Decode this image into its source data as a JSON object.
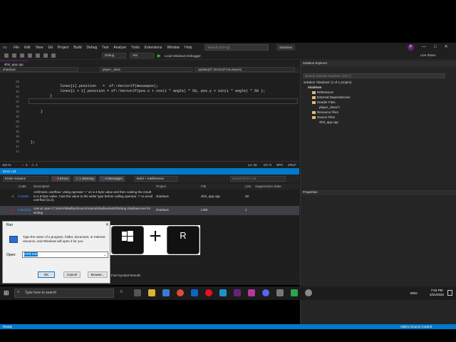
{
  "menubar": {
    "items": [
      "File",
      "Edit",
      "View",
      "Git",
      "Project",
      "Build",
      "Debug",
      "Test",
      "Analyze",
      "Tools",
      "Extensions",
      "Window",
      "Help"
    ],
    "search_placeholder": "Search (Ctrl+Q)",
    "title": "shadows",
    "avatar": "P",
    "win_min": "—",
    "win_max": "□",
    "win_close": "✕"
  },
  "toolbar": {
    "config": "Debug",
    "platform": "x64",
    "run_label": "Local Windows Debugger",
    "live_share": "Live Share"
  },
  "doc_tabs": [
    {
      "label": "sfml_app.cpp"
    }
  ],
  "navbar": {
    "project": "shadows",
    "scope": "player_class",
    "member": "update(sf::Vector2f mousepos)"
  },
  "editor": {
    "line_numbers": [
      "28",
      "29",
      "30",
      "31",
      "32",
      "33",
      "34",
      "35",
      "36",
      "37",
      "38",
      "39",
      "40",
      "41",
      "42"
    ],
    "lines": [
      {
        "t": "lines[i].position   =  sf::Vector2f(mousepos);"
      },
      {
        "t": "lines[i + 1].position = sf::Vector2f(pos.x + cos(i * angle) * 50, pos.y + sin(i * angle) * 50 );"
      },
      {
        "t": "}"
      },
      {
        "t": "}"
      },
      {
        "t": "};"
      }
    ],
    "status": {
      "zoom": "110 %",
      "errors": "2",
      "warnings": "1",
      "ln": "Ln: 32",
      "ch": "Ch: 9",
      "spc": "SPC",
      "crlf": "CRLF"
    }
  },
  "error_list": {
    "title": "Error List",
    "scope": "Entire Solution",
    "errors_btn": "2 Errors",
    "warnings_btn": "1 Warning",
    "messages_btn": "0 Messages",
    "build_filter": "Build + IntelliSense",
    "search_placeholder": "Search Error List",
    "headers": {
      "code": "Code",
      "desc": "Description",
      "project": "Project",
      "file": "File",
      "line": "Line",
      "supp": "Suppression State"
    },
    "rows": [
      {
        "code": "C26451",
        "desc": "Arithmetic overflow: Using operator '+' on a 4 byte value and then casting the result to a 8 byte value. Cast the value to the wider type before calling operator '+' to avoid overflow (io.2).",
        "project": "shadows",
        "file": "sfml_app.cpp",
        "line": "30"
      },
      {
        "code": "LNK1104",
        "desc": "cannot open C:\\Users\\Madhyo\\source\\repos\\shadows\\x64\\Debug shadows.exe for writing",
        "project": "shadows",
        "file": "LINK",
        "line": "1"
      }
    ],
    "find_symbol": "Find Symbol Results"
  },
  "solution_explorer": {
    "title": "Solution Explorer",
    "search_placeholder": "Search Solution Explorer (Ctrl+;)",
    "items": [
      "Solution 'shadows' (1 of 1 project)",
      "shadows",
      "References",
      "External Dependencies",
      "Header Files",
      "player_class.h",
      "Resource Files",
      "Source Files",
      "sfml_app.cpp"
    ]
  },
  "properties": {
    "title": "Properties"
  },
  "status_bar": {
    "ready": "Ready",
    "source_control": "Add to Source Control"
  },
  "run_dialog": {
    "title": "Run",
    "description": "Type the name of a program, folder, document, or Internet resource, and Windows will open it for you.",
    "open_label": "Open:",
    "input_value": "cmd.exe",
    "ok": "OK",
    "cancel": "Cancel",
    "browse": "Browse..."
  },
  "shortcut": {
    "plus": "+",
    "r_key": "R"
  },
  "taskbar": {
    "search_placeholder": "Type here to search",
    "language": "ENG",
    "time": "7:04 PM",
    "date": "4/21/2022"
  },
  "colors": {
    "accent": "#007acc",
    "vs_purple": "#68217a",
    "error_red": "#e51400",
    "warning_yellow": "#ffcc00"
  }
}
